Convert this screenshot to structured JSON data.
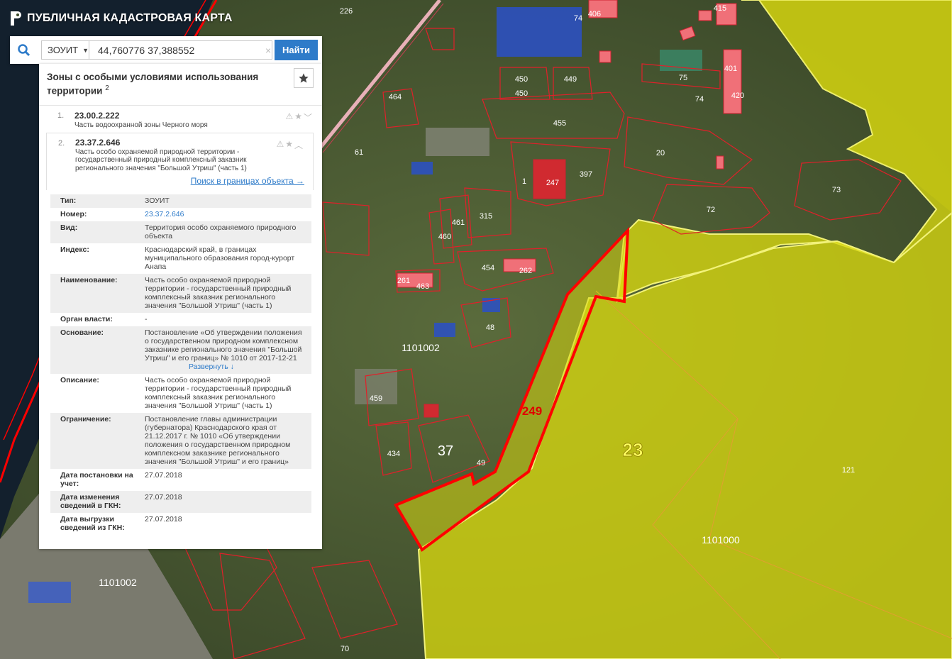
{
  "app": {
    "title": "ПУБЛИЧНАЯ КАДАСТРОВАЯ КАРТА"
  },
  "search": {
    "type_label": "ЗОУИТ",
    "query": "44,760776 37,388552",
    "clear": "×",
    "button_label": "Найти"
  },
  "panel": {
    "title": "Зоны с особыми условиями использования территории",
    "count": "2",
    "items": [
      {
        "num": "1.",
        "code": "23.00.2.222",
        "desc": "Часть водоохранной зоны Черного моря"
      },
      {
        "num": "2.",
        "code": "23.37.2.646",
        "desc": "Часть особо охраняемой природной территории - государственный природный комплексный заказник регионального значения \"Большой Утриш\" (часть 1)"
      }
    ],
    "search_link": "Поиск в границах объекта →",
    "expand_label": "Развернуть ↓",
    "attributes": [
      {
        "k": "Тип:",
        "v": "ЗОУИТ"
      },
      {
        "k": "Номер:",
        "v": "23.37.2.646"
      },
      {
        "k": "Вид:",
        "v": "Территория особо охраняемого природного объекта"
      },
      {
        "k": "Индекс:",
        "v": "Краснодарский край, в границах муниципального образования город-курорт Анапа"
      },
      {
        "k": "Наименование:",
        "v": "Часть особо охраняемой природной территории - государственный природный комплексный заказник регионального значения \"Большой Утриш\" (часть 1)"
      },
      {
        "k": "Орган власти:",
        "v": "-"
      },
      {
        "k": "Основание:",
        "v": "Постановление «Об утверждении положения о государственном природном комплексном заказнике регионального значения \"Большой Утриш\" и его границ» № 1010 от 2017-12-21"
      },
      {
        "k": "Описание:",
        "v": "Часть особо охраняемой природной территории - государственный природный комплексный заказник регионального значения \"Большой Утриш\" (часть 1)"
      },
      {
        "k": "Ограничение:",
        "v": "Постановление главы администрации (губернатора) Краснодарского края от 21.12.2017 г. № 1010 «Об утверждении положения о государственном природном комплексном заказнике регионального значения \"Большой Утриш\" и его границ»"
      },
      {
        "k": "Дата постановки на учет:",
        "v": "27.07.2018"
      },
      {
        "k": "Дата изменения сведений в ГКН:",
        "v": "27.07.2018"
      },
      {
        "k": "Дата выгрузки сведений из ГКН:",
        "v": "27.07.2018"
      }
    ]
  },
  "map": {
    "labels": {
      "l226": "226",
      "l74a": "74",
      "l406": "406",
      "l415": "415",
      "l464": "464",
      "l450a": "450",
      "l450b": "450",
      "l449": "449",
      "l75": "75",
      "l74b": "74",
      "l401": "401",
      "l420": "420",
      "l455": "455",
      "l61": "61",
      "l20": "20",
      "l1": "1",
      "l247": "247",
      "l397": "397",
      "l73": "73",
      "l315": "315",
      "l461": "461",
      "l460": "460",
      "l72": "72",
      "l454": "454",
      "l262": "262",
      "l261": "261",
      "l463": "463",
      "l48": "48",
      "l1101002a": "1101002",
      "l459": "459",
      "l249": "249",
      "l23": "23",
      "l121": "121",
      "l37": "37",
      "l434": "434",
      "l49": "49",
      "l1101000": "1101000",
      "l1101002b": "1101002",
      "l70": "70"
    },
    "colors": {
      "zone_fill": "#d8d810",
      "selected_border": "#ff0000",
      "parcel_border": "#e0202a"
    }
  }
}
